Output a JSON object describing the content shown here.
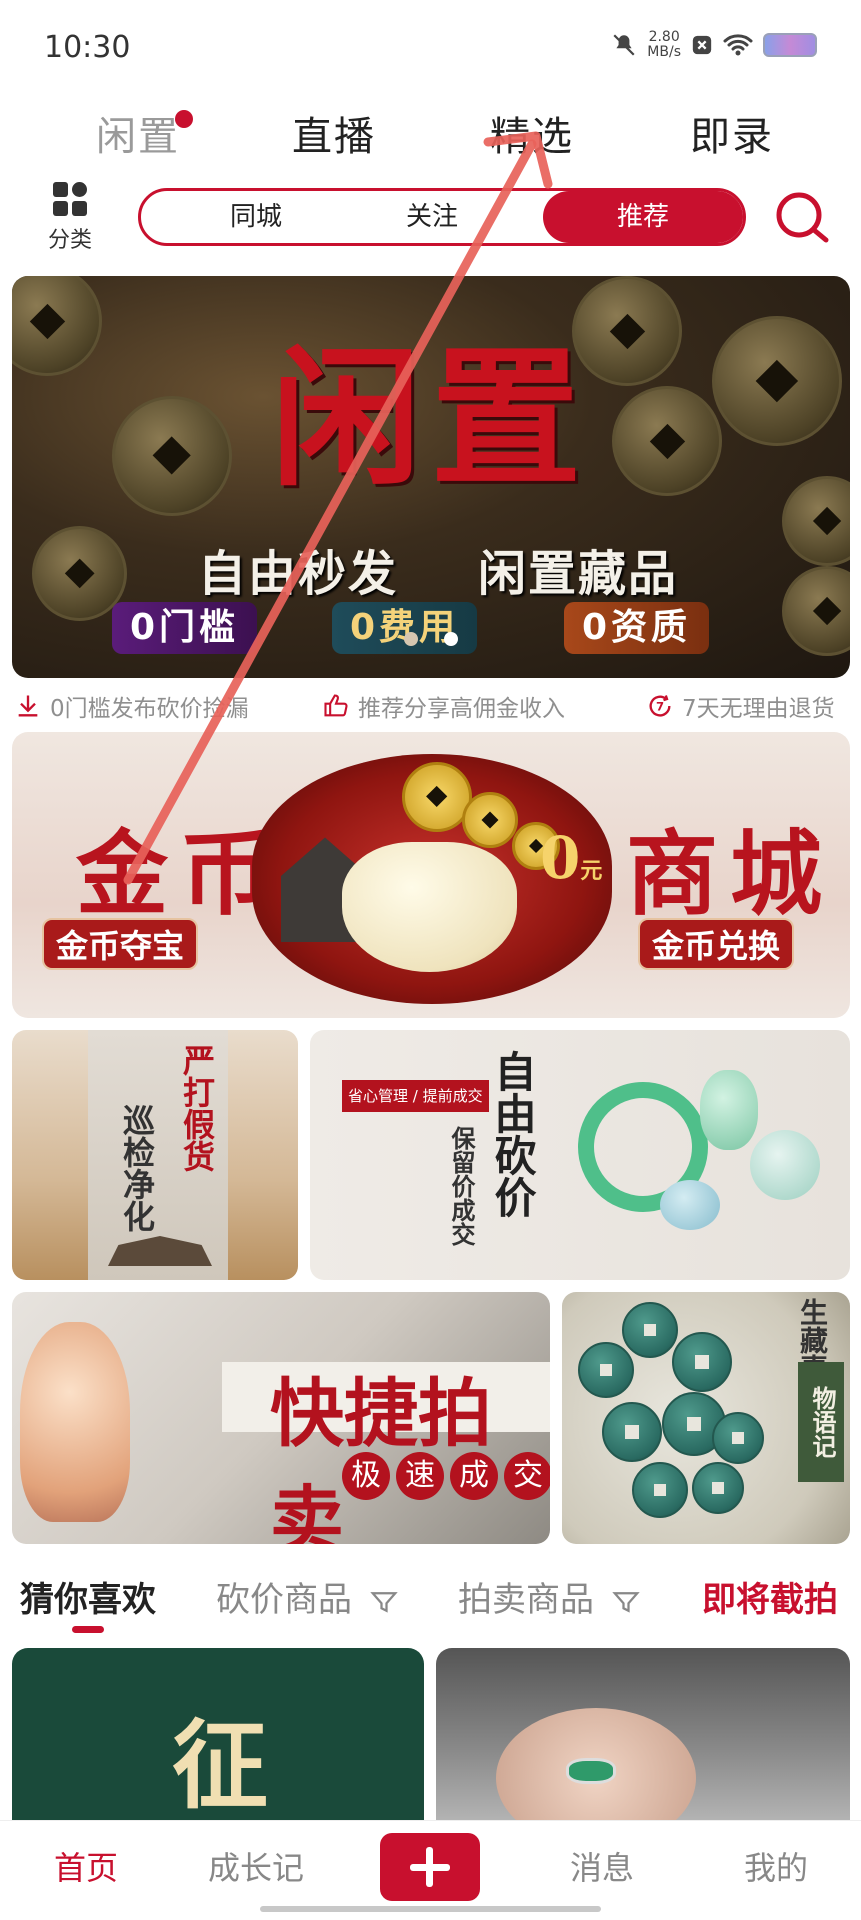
{
  "status_bar": {
    "time": "10:30",
    "net_speed_value": "2.80",
    "net_speed_unit": "MB/s"
  },
  "top_tabs": [
    {
      "label": "闲置",
      "faded": true,
      "has_dot": true
    },
    {
      "label": "直播"
    },
    {
      "label": "精选"
    },
    {
      "label": "即录"
    }
  ],
  "category": {
    "label": "分类"
  },
  "segmented": [
    {
      "label": "同城"
    },
    {
      "label": "关注"
    },
    {
      "label": "推荐",
      "active": true
    }
  ],
  "banner": {
    "title": "闲置",
    "subtitle_left": "自由秒发",
    "subtitle_right": "闲置藏品",
    "chips": [
      "0门槛",
      "0费用",
      "0资质"
    ],
    "page_count": 2
  },
  "features": [
    {
      "icon": "download-icon",
      "text": "0门槛发布砍价捡漏"
    },
    {
      "icon": "thumbs-up-icon",
      "text": "推荐分享高佣金收入"
    },
    {
      "icon": "seven-day-icon",
      "text": "7天无理由退货"
    }
  ],
  "coin_banner": {
    "title_left": "金币",
    "title_right": "商城",
    "price": "0",
    "price_unit": "元",
    "left_button": "金币夺宝",
    "right_button": "金币兑换"
  },
  "tiles": {
    "crackdown": {
      "line1": "严打假货",
      "line2": "巡检净化"
    },
    "bargain": {
      "tag": "省心管理 / 提前成交",
      "title": "自由砍价",
      "subtitle": "保留价成交"
    },
    "auction": {
      "title": "快捷拍卖",
      "balls": [
        "极",
        "速",
        "成",
        "交"
      ]
    },
    "story": {
      "box": "物语记",
      "vertical_text": "生藏喜不生然"
    }
  },
  "filters": [
    {
      "label": "猜你喜欢",
      "active": true
    },
    {
      "label": "砍价商品",
      "has_funnel": true
    },
    {
      "label": "拍卖商品",
      "has_funnel": true
    },
    {
      "label": "即将截拍",
      "hot": true
    }
  ],
  "products": [
    {
      "char": "征"
    }
  ],
  "bottom_nav": [
    {
      "label": "首页",
      "active": true
    },
    {
      "label": "成长记"
    },
    {
      "label": "消息"
    },
    {
      "label": "我的"
    }
  ],
  "colors": {
    "brand_red": "#c8102e",
    "muted_gray": "#8f8f8f"
  }
}
